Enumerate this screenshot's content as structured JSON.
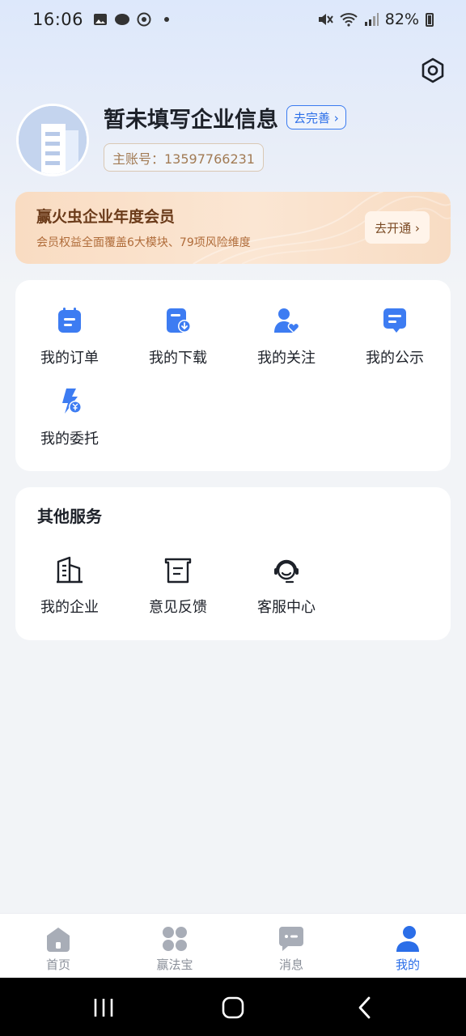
{
  "status_bar": {
    "time": "16:06",
    "battery": "82%"
  },
  "profile": {
    "company_name": "暂未填写企业信息",
    "complete_label": "去完善 ›",
    "account": "主账号：13597766231"
  },
  "membership": {
    "title": "赢火虫企业年度会员",
    "description": "会员权益全面覆盖6大模块、79项风险维度",
    "button": "去开通 ›"
  },
  "functions": {
    "items": [
      {
        "label": "我的订单",
        "icon": "order-icon"
      },
      {
        "label": "我的下载",
        "icon": "download-icon"
      },
      {
        "label": "我的关注",
        "icon": "follow-icon"
      },
      {
        "label": "我的公示",
        "icon": "announcement-icon"
      },
      {
        "label": "我的委托",
        "icon": "entrust-icon"
      }
    ]
  },
  "other_services": {
    "title": "其他服务",
    "items": [
      {
        "label": "我的企业",
        "icon": "enterprise-icon"
      },
      {
        "label": "意见反馈",
        "icon": "feedback-icon"
      },
      {
        "label": "客服中心",
        "icon": "customer-service-icon"
      }
    ]
  },
  "bottom_nav": {
    "items": [
      {
        "label": "首页",
        "icon": "home-icon",
        "active": false
      },
      {
        "label": "赢法宝",
        "icon": "grid-icon",
        "active": false
      },
      {
        "label": "消息",
        "icon": "message-icon",
        "active": false
      },
      {
        "label": "我的",
        "icon": "profile-icon",
        "active": true
      }
    ]
  },
  "colors": {
    "accent": "#2b6ee8",
    "icon_blue": "#3d7cf2",
    "member_brown": "#6b3b1a"
  }
}
